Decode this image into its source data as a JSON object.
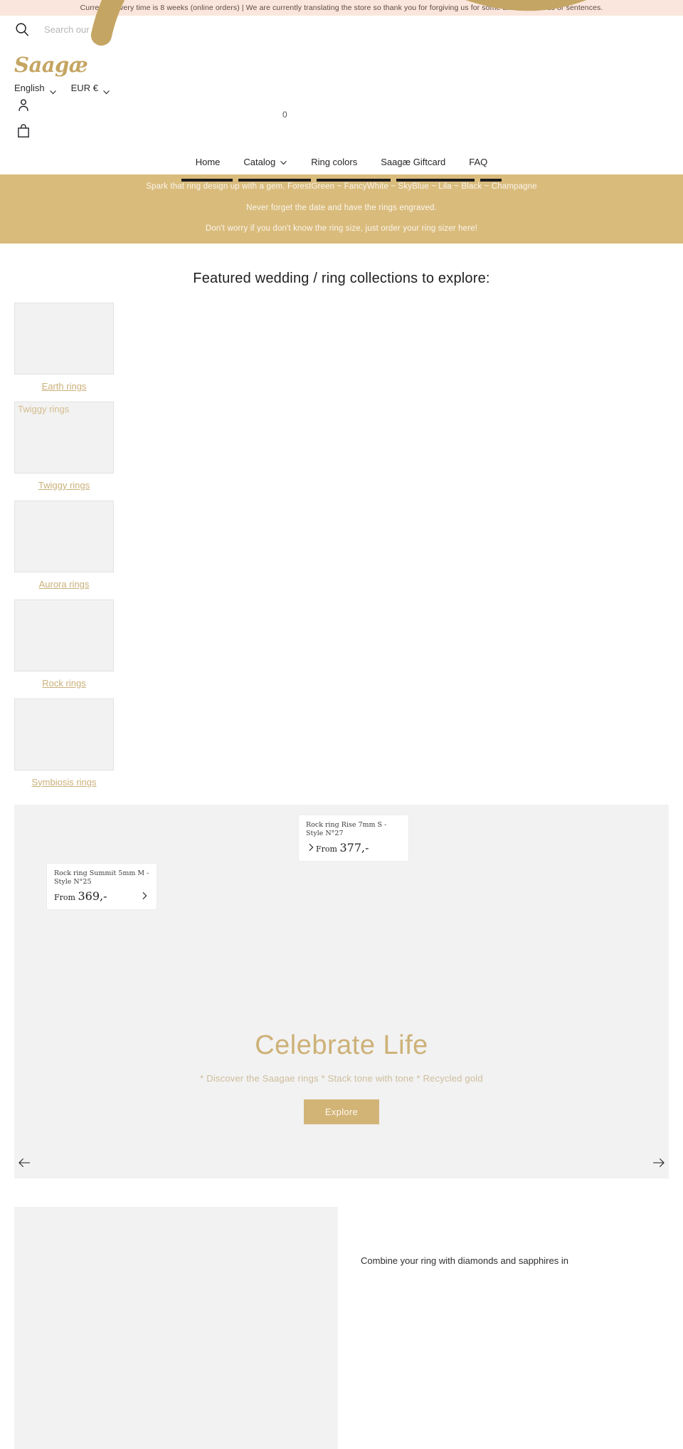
{
  "announcement": {
    "text": "Current delivery time is 8 weeks (online orders) | We are currently translating the store so thank you for forgiving us for some awkward words or sentences."
  },
  "search": {
    "icon": "search-icon",
    "placeholder": "Search our store",
    "value": ""
  },
  "brand": {
    "logo_text": "Saagæ",
    "logo_color": "#c5a563"
  },
  "locale": {
    "language": "English",
    "currency": "EUR €",
    "chevron_icon": "chevron-down-icon"
  },
  "header_icons": {
    "account": "user-icon",
    "cart": "shopping-bag-icon",
    "cart_count": "0"
  },
  "nav": {
    "items": [
      {
        "label": "Home",
        "has_caret": false
      },
      {
        "label": "Catalog",
        "has_caret": true
      },
      {
        "label": "Ring colors",
        "has_caret": false
      },
      {
        "label": "Saagæ Giftcard",
        "has_caret": false
      },
      {
        "label": "FAQ",
        "has_caret": false
      }
    ]
  },
  "promo_band": {
    "background": "#d9bb7c",
    "lines": [
      "Spark that ring design up with a gem. ForestGreen ~ FancyWhite ~ SkyBlue ~ Lila ~ Black ~ Champagne",
      "Never forget the date and have the rings engraved.",
      "Don't worry if you don't know the ring size, just order your ring sizer here!"
    ]
  },
  "featured": {
    "heading": "Featured wedding / ring collections to explore:",
    "collections": [
      {
        "label": "Earth rings",
        "thumb_alt": ""
      },
      {
        "label": "Twiggy rings",
        "thumb_alt": "Twiggy rings"
      },
      {
        "label": "Aurora rings",
        "thumb_alt": ""
      },
      {
        "label": "Rock rings",
        "thumb_alt": ""
      },
      {
        "label": "Symbiosis rings",
        "thumb_alt": ""
      }
    ]
  },
  "hero": {
    "title": "Celebrate Life",
    "subtitle": "* Discover the Saagae rings * Stack tone with tone * Recycled gold",
    "button_label": "Explore",
    "button_color": "#d2b477",
    "title_color": "#cdb177",
    "prev_icon": "arrow-left-icon",
    "next_icon": "arrow-right-icon",
    "hotspots": [
      {
        "title": "Rock ring Summit 5mm M - Style N°25",
        "price_prefix": "From",
        "price": "369,-",
        "arrow_icon": "chevron-right-icon",
        "arrow_side": "right"
      },
      {
        "title": "Rock ring Rise 7mm S - Style N°27",
        "price_prefix": "From",
        "price": "377,-",
        "arrow_icon": "chevron-right-icon",
        "arrow_side": "left"
      }
    ]
  },
  "rich_block": {
    "text": "Combine your ring with diamonds and sapphires in"
  }
}
